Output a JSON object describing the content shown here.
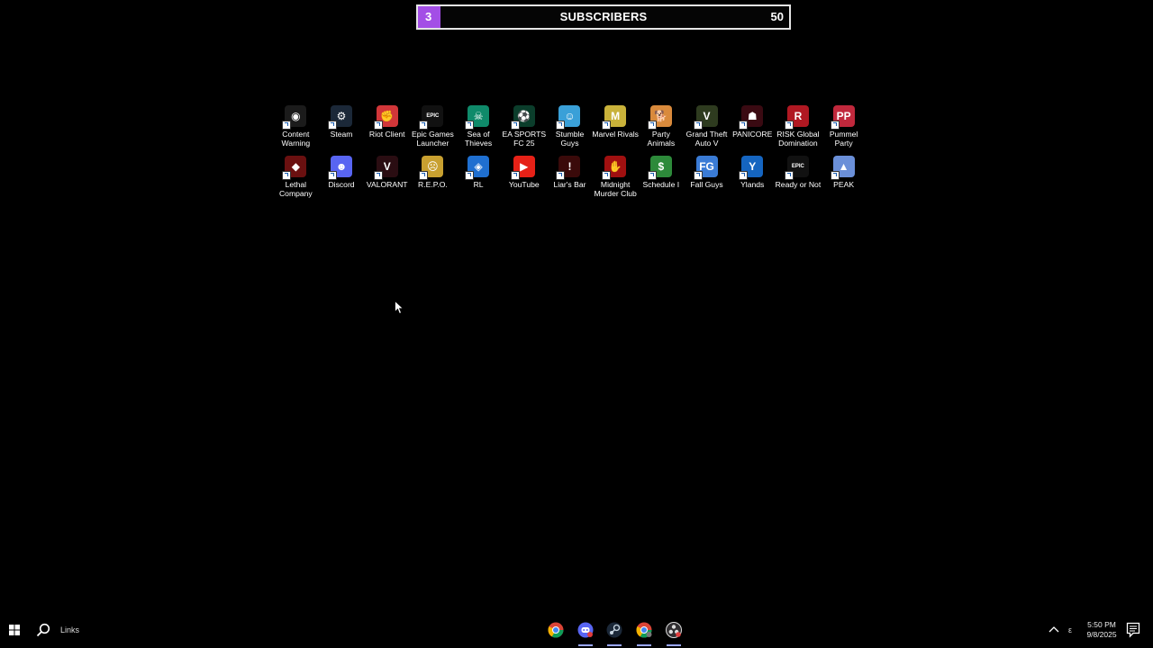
{
  "subscriber_bar": {
    "current": "3",
    "title": "SUBSCRIBERS",
    "goal": "50",
    "progress_fraction": 0.06,
    "fill_color": "#a34ee6",
    "border_color": "#e6e6e6"
  },
  "desktop_icons": [
    {
      "label": "Content Warning",
      "color": "#1b1b1b",
      "glyph": "◉",
      "icon": "content-warning-icon"
    },
    {
      "label": "Steam",
      "color": "#1b2838",
      "glyph": "⚙",
      "icon": "steam-icon"
    },
    {
      "label": "Riot Client",
      "color": "#d13639",
      "glyph": "✊",
      "icon": "riot-client-icon"
    },
    {
      "label": "Epic Games Launcher",
      "color": "#111111",
      "glyph": "EPIC",
      "icon": "epic-games-icon"
    },
    {
      "label": "Sea of Thieves",
      "color": "#0f8a6a",
      "glyph": "☠",
      "icon": "sea-of-thieves-icon"
    },
    {
      "label": "EA SPORTS FC 25",
      "color": "#0b3d2b",
      "glyph": "⚽",
      "icon": "ea-fc-icon"
    },
    {
      "label": "Stumble Guys",
      "color": "#3aa0d8",
      "glyph": "☺",
      "icon": "stumble-guys-icon"
    },
    {
      "label": "Marvel Rivals",
      "color": "#c9b23a",
      "glyph": "M",
      "icon": "marvel-rivals-icon"
    },
    {
      "label": "Party Animals",
      "color": "#d98a3c",
      "glyph": "🐕",
      "icon": "party-animals-icon"
    },
    {
      "label": "Grand Theft Auto V",
      "color": "#2e3b1f",
      "glyph": "V",
      "icon": "gta-v-icon"
    },
    {
      "label": "PANICORE",
      "color": "#3a0a12",
      "glyph": "☗",
      "icon": "panicore-icon"
    },
    {
      "label": "RISK Global Domination",
      "color": "#b01822",
      "glyph": "R",
      "icon": "risk-icon"
    },
    {
      "label": "Pummel Party",
      "color": "#c0283c",
      "glyph": "PP",
      "icon": "pummel-party-icon"
    },
    {
      "label": "Lethal Company",
      "color": "#6a1010",
      "glyph": "◆",
      "icon": "lethal-company-icon"
    },
    {
      "label": "Discord",
      "color": "#5865f2",
      "glyph": "☻",
      "icon": "discord-icon"
    },
    {
      "label": "VALORANT",
      "color": "#2a0d12",
      "glyph": "V",
      "icon": "valorant-icon"
    },
    {
      "label": "R.E.P.O.",
      "color": "#c8a030",
      "glyph": "☹",
      "icon": "repo-icon"
    },
    {
      "label": "RL",
      "color": "#1f6fd0",
      "glyph": "◈",
      "icon": "rocket-league-icon"
    },
    {
      "label": "YouTube",
      "color": "#e62117",
      "glyph": "▶",
      "icon": "youtube-icon"
    },
    {
      "label": "Liar's Bar",
      "color": "#3a0a0a",
      "glyph": "!",
      "icon": "liars-bar-icon"
    },
    {
      "label": "Midnight Murder Club",
      "color": "#a01010",
      "glyph": "✋",
      "icon": "midnight-murder-club-icon"
    },
    {
      "label": "Schedule I",
      "color": "#2d8a3a",
      "glyph": "$",
      "icon": "schedule-i-icon"
    },
    {
      "label": "Fall Guys",
      "color": "#3a7bd5",
      "glyph": "FG",
      "icon": "fall-guys-icon"
    },
    {
      "label": "Ylands",
      "color": "#1565c0",
      "glyph": "Y",
      "icon": "ylands-icon"
    },
    {
      "label": "Ready or Not",
      "color": "#111111",
      "glyph": "EPIC",
      "icon": "ready-or-not-icon"
    },
    {
      "label": "PEAK",
      "color": "#6a8fd8",
      "glyph": "▲",
      "icon": "peak-icon"
    }
  ],
  "taskbar": {
    "links_label": "Links",
    "apps": [
      {
        "name": "chrome",
        "icon": "chrome-icon",
        "active": false
      },
      {
        "name": "discord",
        "icon": "discord-taskbar-icon",
        "active": true
      },
      {
        "name": "steam",
        "icon": "steam-taskbar-icon",
        "active": true
      },
      {
        "name": "chrome-profile",
        "icon": "chrome-profile-icon",
        "active": true
      },
      {
        "name": "obs",
        "icon": "obs-icon",
        "active": true
      }
    ],
    "tray_lang": "ε",
    "time": "5:50 PM",
    "date": "9/8/2025"
  }
}
